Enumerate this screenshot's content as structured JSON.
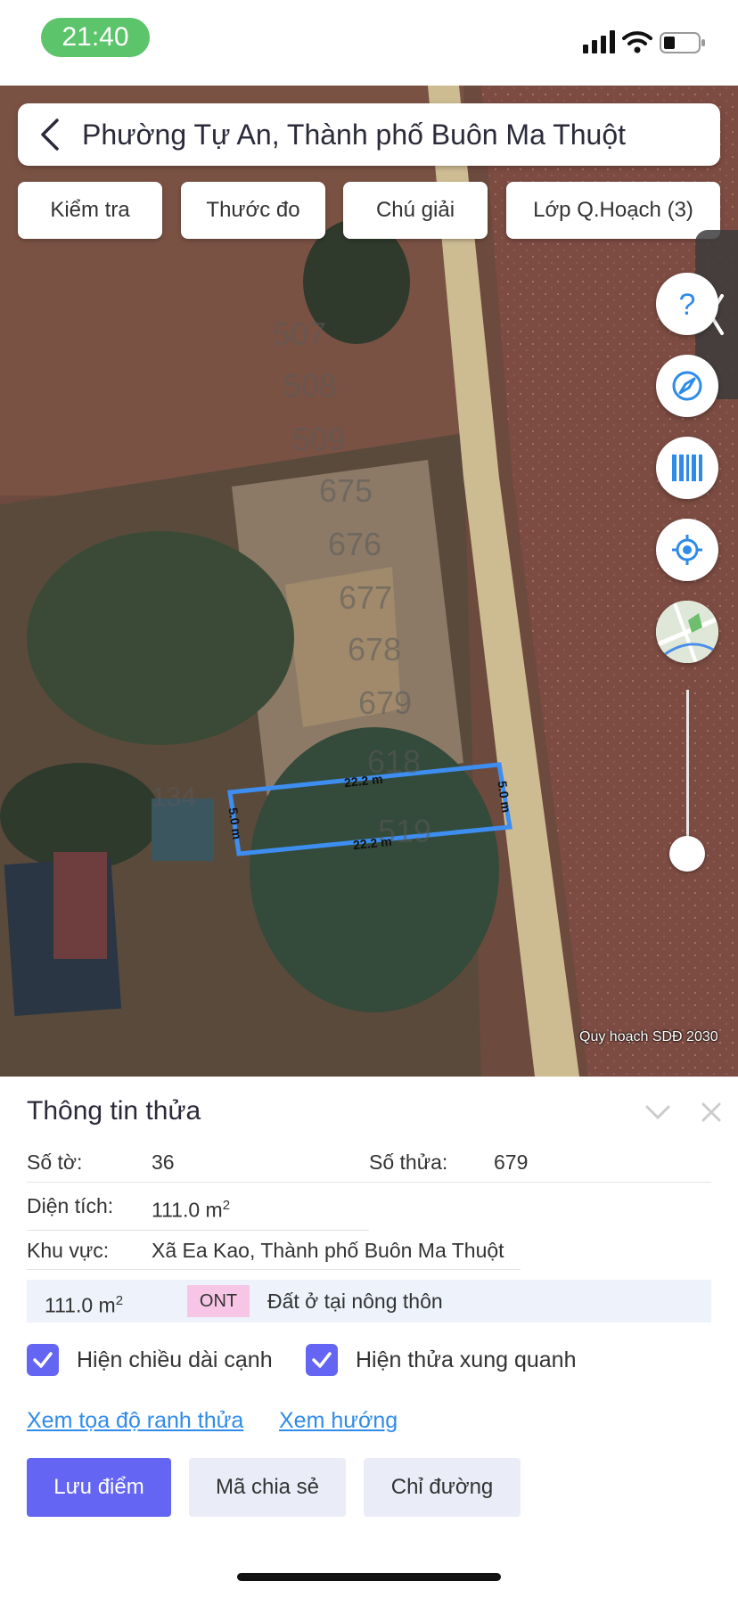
{
  "status_bar": {
    "time": "21:40"
  },
  "header": {
    "title": "Phường Tự An, Thành phố Buôn Ma Thuột"
  },
  "top_buttons": [
    {
      "label": "Kiểm tra"
    },
    {
      "label": "Thước đo"
    },
    {
      "label": "Chú giải"
    },
    {
      "label": "Lớp Q.Hoạch (3)"
    }
  ],
  "map": {
    "caption": "Quy hoạch SDĐ 2030",
    "parcel_numbers": [
      "507",
      "508",
      "509",
      "675",
      "676",
      "677",
      "678",
      "679",
      "618",
      "519",
      "134"
    ],
    "edge_labels": [
      "22.2 m",
      "22.2 m",
      "5.0 m",
      "5.0 m"
    ],
    "side_buttons": [
      "help-icon",
      "compass-icon",
      "barcode-icon",
      "locate-icon",
      "map-thumbnail"
    ],
    "zoom_level": 0.08
  },
  "info": {
    "title": "Thông tin thửa",
    "so_to_label": "Số tờ:",
    "so_to_value": "36",
    "so_thua_label": "Số thửa:",
    "so_thua_value": "679",
    "dien_tich_label": "Diện tích:",
    "dien_tich_value": "111.0 m",
    "dien_tich_unit_sup": "2",
    "khu_vuc_label": "Khu vực:",
    "khu_vuc_value": "Xã Ea Kao, Thành phố Buôn Ma Thuột",
    "land_use": {
      "area": "111.0 m",
      "area_sup": "2",
      "code": "ONT",
      "description": "Đất ở tại nông thôn"
    }
  },
  "options": {
    "show_edge_length": {
      "label": "Hiện chiều dài cạnh",
      "checked": true
    },
    "show_neighbors": {
      "label": "Hiện thửa xung quanh",
      "checked": true
    }
  },
  "links": {
    "coords": "Xem tọa độ ranh thửa",
    "direction": "Xem hướng"
  },
  "actions": {
    "save": "Lưu điểm",
    "share": "Mã chia sẻ",
    "route": "Chỉ đường"
  },
  "colors": {
    "accent": "#6465f2",
    "link": "#2f8bea",
    "parcel_outline": "#3d8ef0",
    "time_pill": "#5cc46a"
  }
}
